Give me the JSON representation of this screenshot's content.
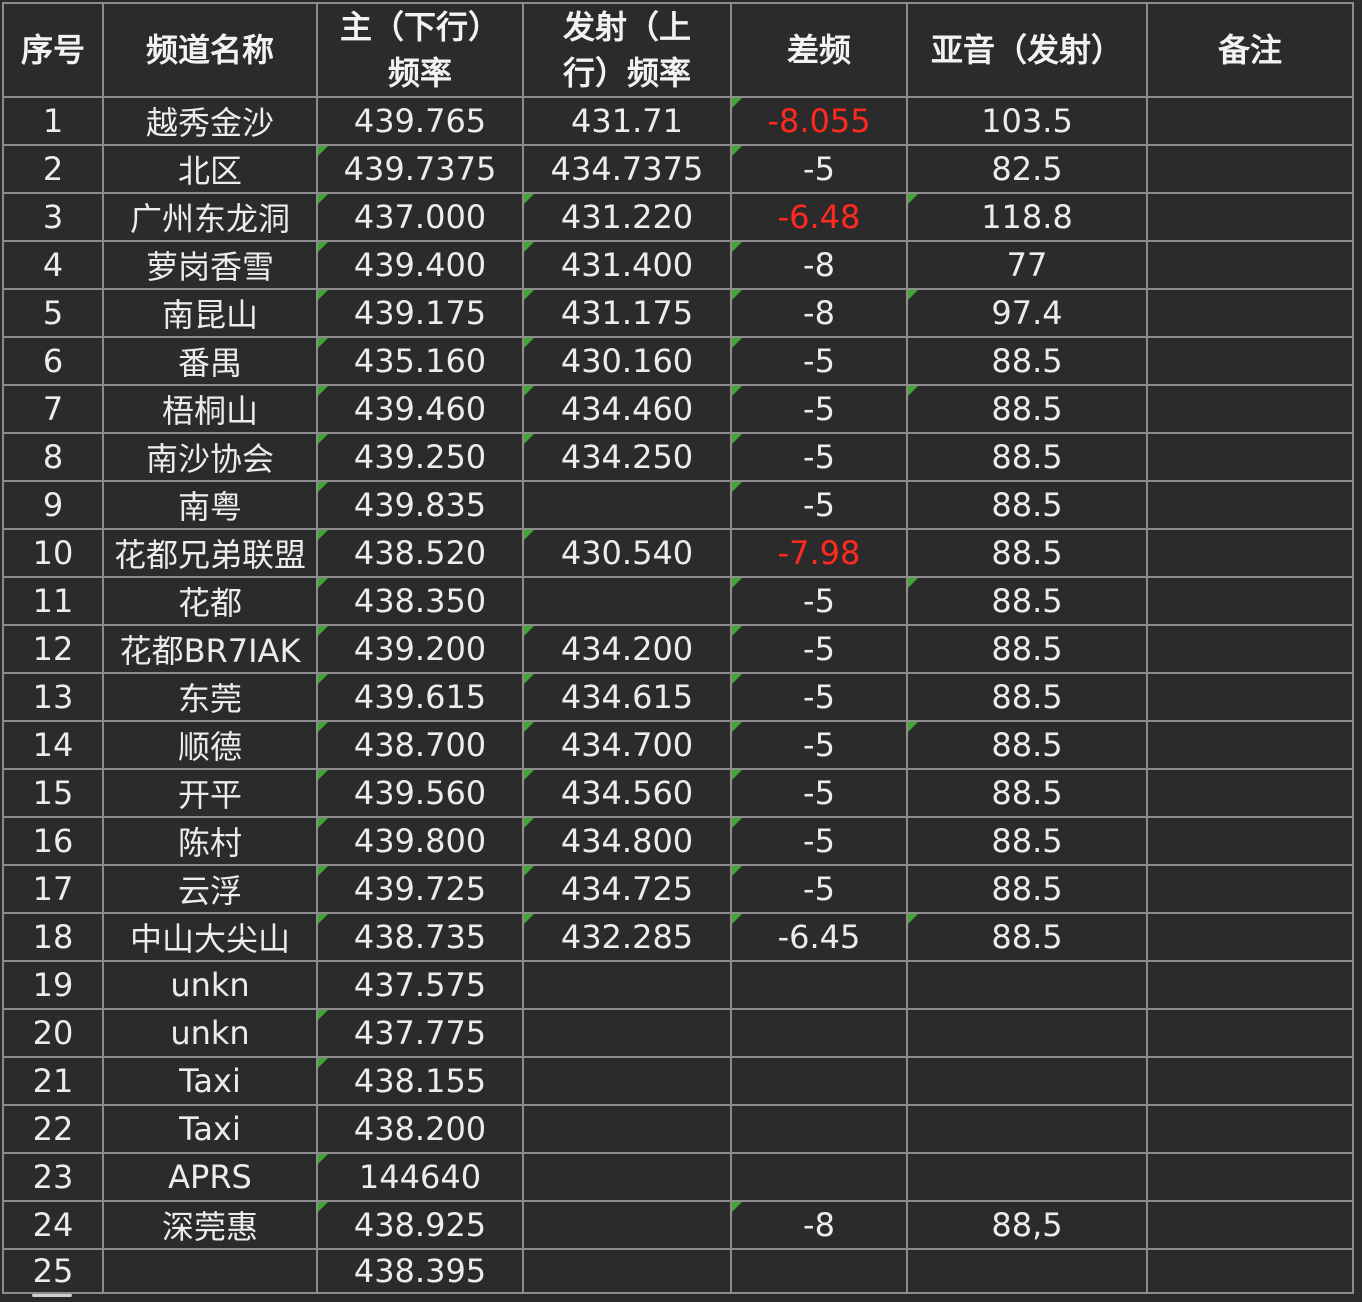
{
  "headers": [
    "序号",
    "频道名称",
    "主（下行）频率",
    "发射（上行）频率",
    "差频",
    "亚音（发射）",
    "备注"
  ],
  "rows": [
    [
      "1",
      "越秀金沙",
      "439.765",
      "431.71",
      "-8.055",
      "103.5",
      ""
    ],
    [
      "2",
      "北区",
      "439.7375",
      "434.7375",
      "-5",
      "82.5",
      ""
    ],
    [
      "3",
      "广州东龙洞",
      "437.000",
      "431.220",
      "-6.48",
      "118.8",
      ""
    ],
    [
      "4",
      "萝岗香雪",
      "439.400",
      "431.400",
      "-8",
      "77",
      ""
    ],
    [
      "5",
      "南昆山",
      "439.175",
      "431.175",
      "-8",
      "97.4",
      ""
    ],
    [
      "6",
      "番禺",
      "435.160",
      "430.160",
      "-5",
      "88.5",
      ""
    ],
    [
      "7",
      "梧桐山",
      "439.460",
      "434.460",
      "-5",
      "88.5",
      ""
    ],
    [
      "8",
      "南沙协会",
      "439.250",
      "434.250",
      "-5",
      "88.5",
      ""
    ],
    [
      "9",
      "南粤",
      "439.835",
      "",
      "-5",
      "88.5",
      ""
    ],
    [
      "10",
      "花都兄弟联盟",
      "438.520",
      "430.540",
      "-7.98",
      "88.5",
      ""
    ],
    [
      "11",
      "花都",
      "438.350",
      "",
      "-5",
      "88.5",
      ""
    ],
    [
      "12",
      "花都BR7IAK",
      "439.200",
      "434.200",
      "-5",
      "88.5",
      ""
    ],
    [
      "13",
      "东莞",
      "439.615",
      "434.615",
      "-5",
      "88.5",
      ""
    ],
    [
      "14",
      "顺德",
      "438.700",
      "434.700",
      "-5",
      "88.5",
      ""
    ],
    [
      "15",
      "开平",
      "439.560",
      "434.560",
      "-5",
      "88.5",
      ""
    ],
    [
      "16",
      "陈村",
      "439.800",
      "434.800",
      "-5",
      "88.5",
      ""
    ],
    [
      "17",
      "云浮",
      "439.725",
      "434.725",
      "-5",
      "88.5",
      ""
    ],
    [
      "18",
      "中山大尖山",
      "438.735",
      "432.285",
      "-6.45",
      "88.5",
      ""
    ],
    [
      "19",
      "unkn",
      "437.575",
      "",
      "",
      "",
      ""
    ],
    [
      "20",
      "unkn",
      "437.775",
      "",
      "",
      "",
      ""
    ],
    [
      "21",
      "Taxi",
      "438.155",
      "",
      "",
      "",
      ""
    ],
    [
      "22",
      "Taxi",
      "438.200",
      "",
      "",
      "",
      ""
    ],
    [
      "23",
      "APRS",
      "144640",
      "",
      "",
      "",
      ""
    ],
    [
      "24",
      "深莞惠",
      "438.925",
      "",
      "-8",
      "88,5",
      ""
    ],
    [
      "25",
      "",
      "438.395",
      "",
      "",
      "",
      ""
    ]
  ],
  "red_cells": [
    [
      0,
      4
    ],
    [
      2,
      4
    ],
    [
      9,
      4
    ]
  ],
  "flag_cells": [
    [
      0,
      4
    ],
    [
      1,
      2
    ],
    [
      1,
      4
    ],
    [
      2,
      2
    ],
    [
      2,
      3
    ],
    [
      2,
      5
    ],
    [
      3,
      2
    ],
    [
      3,
      3
    ],
    [
      3,
      4
    ],
    [
      4,
      2
    ],
    [
      4,
      3
    ],
    [
      4,
      4
    ],
    [
      4,
      5
    ],
    [
      5,
      2
    ],
    [
      5,
      3
    ],
    [
      5,
      4
    ],
    [
      6,
      2
    ],
    [
      6,
      3
    ],
    [
      6,
      4
    ],
    [
      6,
      5
    ],
    [
      7,
      2
    ],
    [
      7,
      3
    ],
    [
      7,
      4
    ],
    [
      8,
      2
    ],
    [
      8,
      4
    ],
    [
      9,
      2
    ],
    [
      9,
      3
    ],
    [
      10,
      2
    ],
    [
      10,
      4
    ],
    [
      10,
      5
    ],
    [
      11,
      2
    ],
    [
      11,
      3
    ],
    [
      11,
      4
    ],
    [
      12,
      2
    ],
    [
      12,
      3
    ],
    [
      12,
      4
    ],
    [
      13,
      2
    ],
    [
      13,
      3
    ],
    [
      13,
      4
    ],
    [
      13,
      5
    ],
    [
      14,
      2
    ],
    [
      14,
      3
    ],
    [
      14,
      4
    ],
    [
      15,
      2
    ],
    [
      15,
      3
    ],
    [
      15,
      4
    ],
    [
      16,
      2
    ],
    [
      16,
      3
    ],
    [
      16,
      4
    ],
    [
      17,
      2
    ],
    [
      17,
      3
    ],
    [
      17,
      4
    ],
    [
      17,
      5
    ],
    [
      19,
      2
    ],
    [
      20,
      2
    ],
    [
      22,
      2
    ],
    [
      23,
      2
    ],
    [
      23,
      4
    ]
  ],
  "colors": {
    "background": "#2b2b2b",
    "grid": "#8c8c8c",
    "text": "#ececec",
    "negative_red": "#ff2a1f",
    "flag_green": "#3fa535"
  }
}
